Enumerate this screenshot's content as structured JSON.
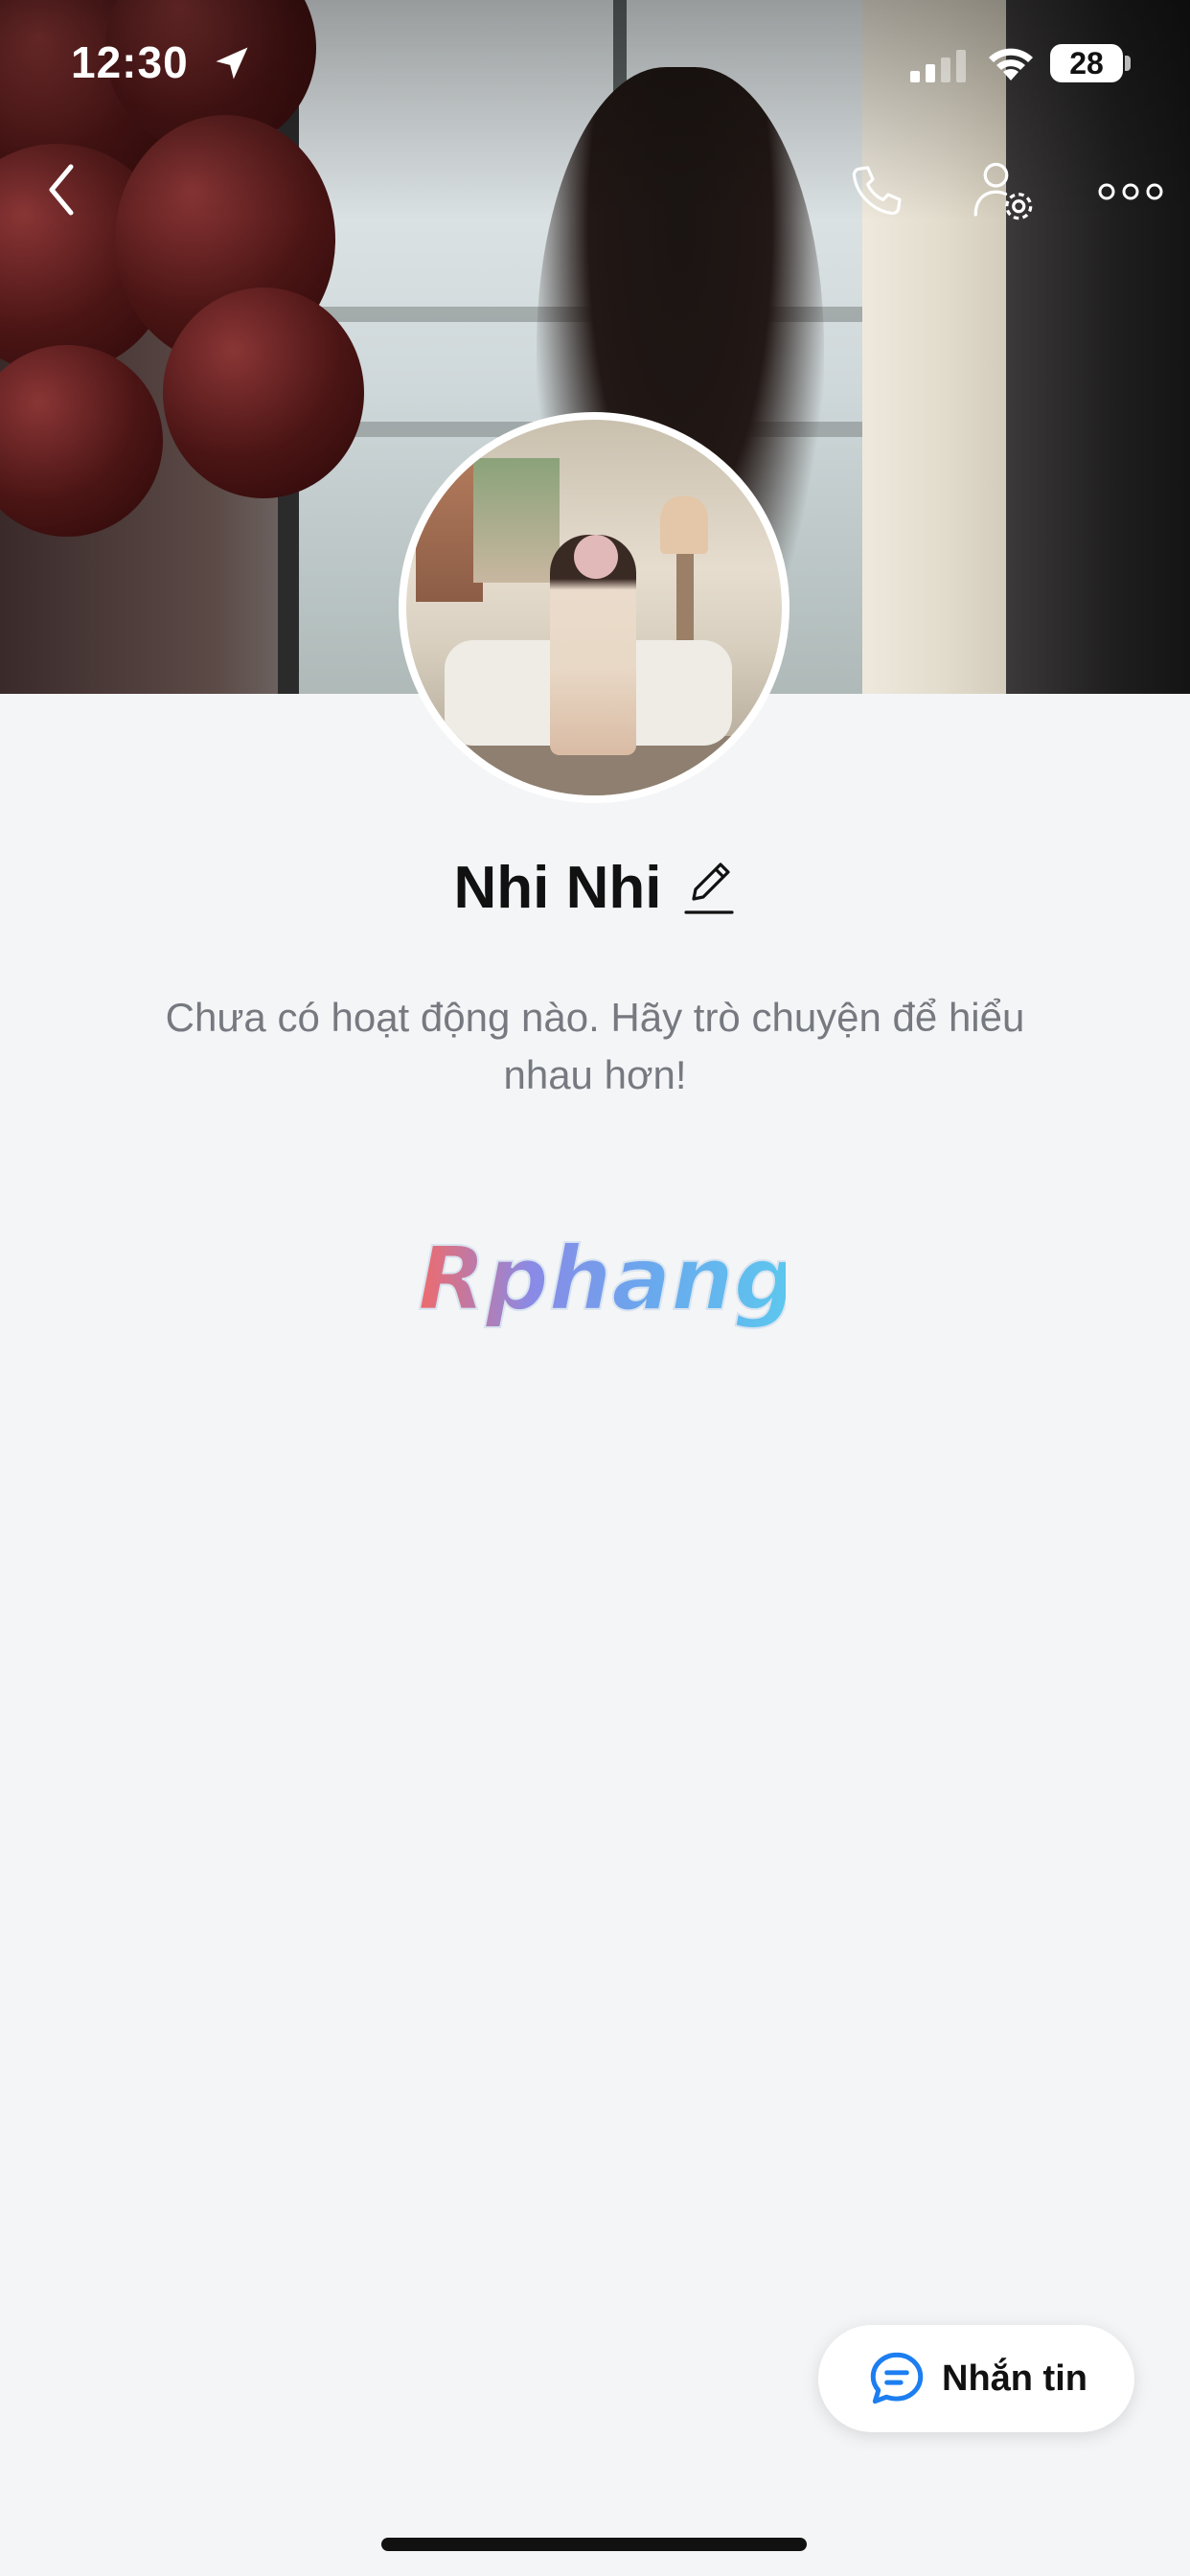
{
  "status_bar": {
    "time": "12:30",
    "battery": "28"
  },
  "nav": {
    "back_icon": "chevron-left-icon",
    "call_icon": "phone-icon",
    "settings_icon": "user-settings-icon",
    "more_icon": "more-horizontal-icon"
  },
  "profile": {
    "name": "Nhi Nhi",
    "empty_message_line1": "Chưa có hoạt động nào. Hãy trò chuyện để hiểu",
    "empty_message_line2": "nhau hơn!"
  },
  "watermark": {
    "text": "Rphang"
  },
  "actions": {
    "message_label": "Nhắn tin"
  },
  "colors": {
    "accent": "#1c7ef0",
    "background": "#f4f5f7",
    "text_primary": "#111111",
    "text_secondary": "#767a80"
  }
}
